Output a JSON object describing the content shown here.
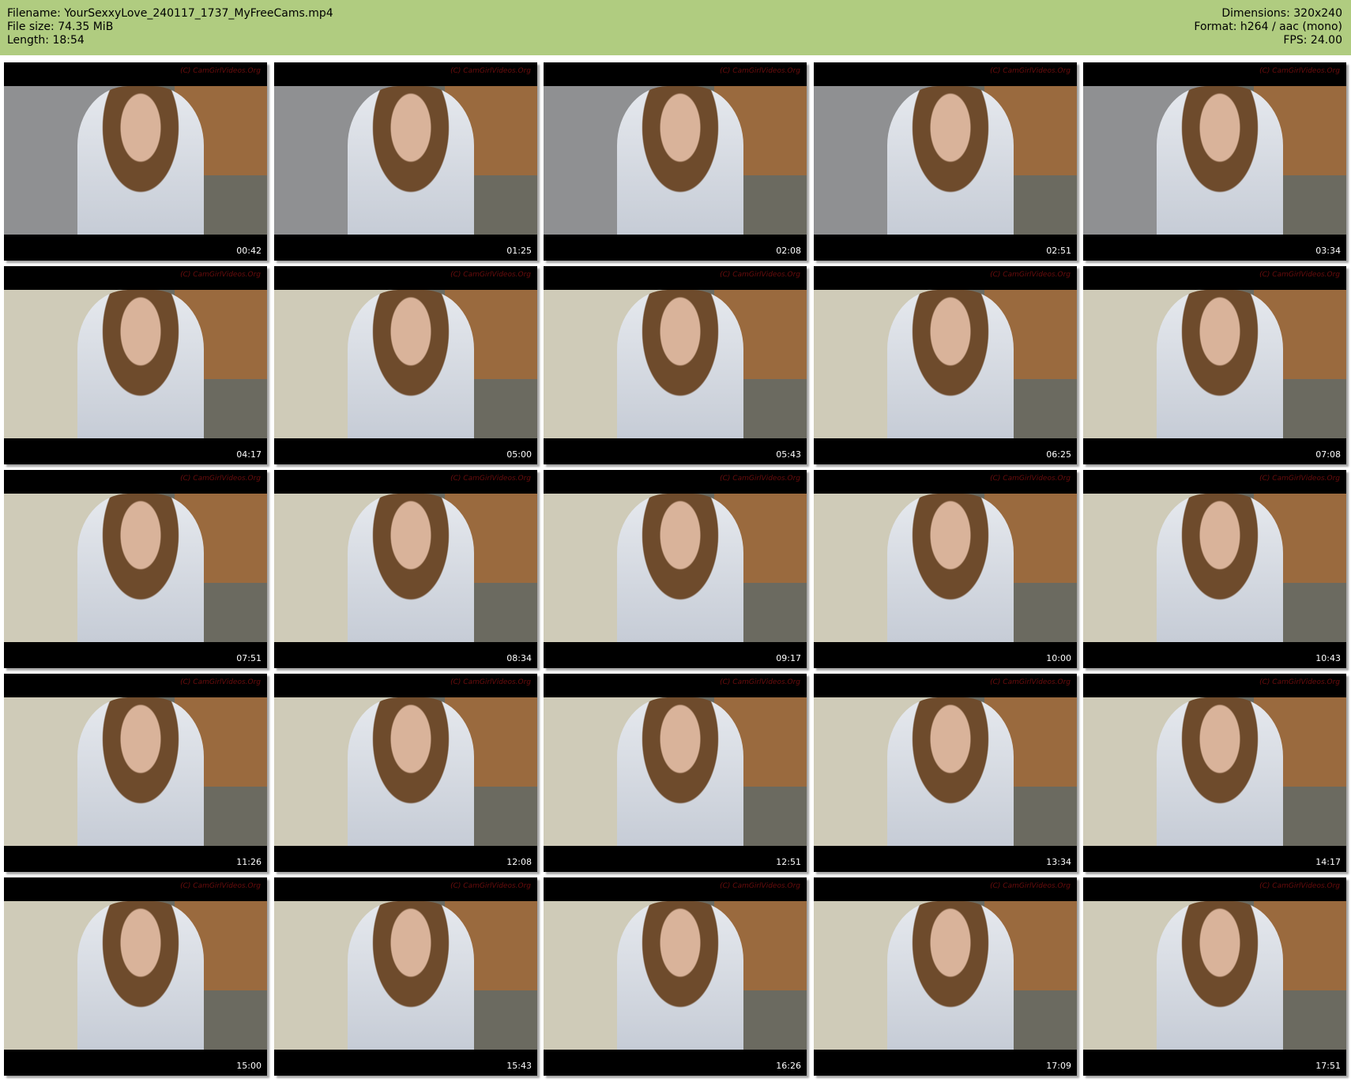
{
  "header": {
    "filename_label": "Filename:",
    "filename": "YourSexxyLove_240117_1737_MyFreeCams.mp4",
    "filesize_label": "File size:",
    "filesize": "74.35 MiB",
    "length_label": "Length:",
    "length": "18:54",
    "dimensions_label": "Dimensions:",
    "dimensions": "320x240",
    "format_label": "Format:",
    "format": "h264 / aac (mono)",
    "fps_label": "FPS:",
    "fps": "24.00"
  },
  "watermark": "(C) CamGirlVideos.Org",
  "thumbnails": [
    {
      "timestamp": "00:42",
      "scene": "kitchen"
    },
    {
      "timestamp": "01:25",
      "scene": "kitchen"
    },
    {
      "timestamp": "02:08",
      "scene": "kitchen"
    },
    {
      "timestamp": "02:51",
      "scene": "kitchen"
    },
    {
      "timestamp": "03:34",
      "scene": "kitchen"
    },
    {
      "timestamp": "04:17",
      "scene": "curtain"
    },
    {
      "timestamp": "05:00",
      "scene": "curtain"
    },
    {
      "timestamp": "05:43",
      "scene": "curtain"
    },
    {
      "timestamp": "06:25",
      "scene": "curtain"
    },
    {
      "timestamp": "07:08",
      "scene": "curtain"
    },
    {
      "timestamp": "07:51",
      "scene": "curtain"
    },
    {
      "timestamp": "08:34",
      "scene": "curtain"
    },
    {
      "timestamp": "09:17",
      "scene": "curtain"
    },
    {
      "timestamp": "10:00",
      "scene": "curtain"
    },
    {
      "timestamp": "10:43",
      "scene": "curtain"
    },
    {
      "timestamp": "11:26",
      "scene": "curtain"
    },
    {
      "timestamp": "12:08",
      "scene": "curtain"
    },
    {
      "timestamp": "12:51",
      "scene": "curtain"
    },
    {
      "timestamp": "13:34",
      "scene": "curtain"
    },
    {
      "timestamp": "14:17",
      "scene": "curtain"
    },
    {
      "timestamp": "15:00",
      "scene": "curtain"
    },
    {
      "timestamp": "15:43",
      "scene": "curtain"
    },
    {
      "timestamp": "16:26",
      "scene": "curtain"
    },
    {
      "timestamp": "17:09",
      "scene": "curtain"
    },
    {
      "timestamp": "17:51",
      "scene": "curtain"
    }
  ],
  "colors": {
    "header_bg": "#b0cc80",
    "kitchen_bg": "#8f9092",
    "curtain_bg": "#cfcbb8"
  }
}
